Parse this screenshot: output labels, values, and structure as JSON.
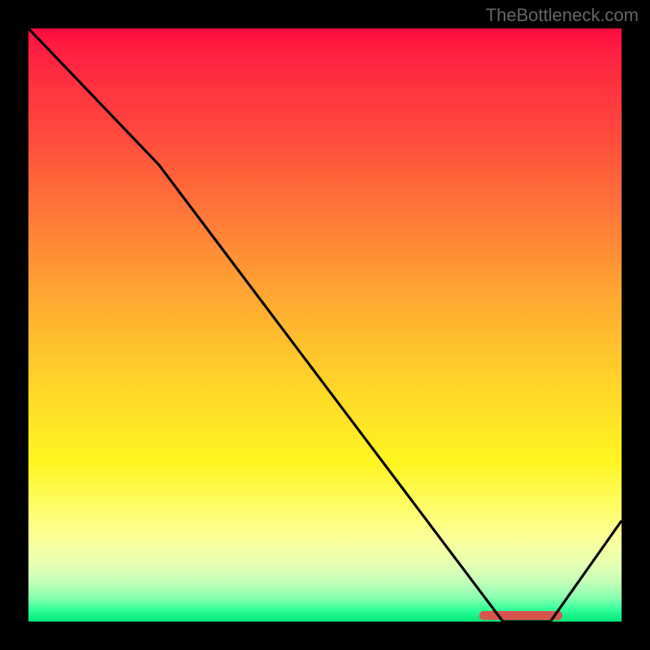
{
  "attribution": "TheBottleneck.com",
  "chart_data": {
    "type": "line",
    "title": "",
    "xlabel": "",
    "ylabel": "",
    "xlim": [
      0,
      100
    ],
    "ylim": [
      0,
      100
    ],
    "x": [
      0,
      22,
      80,
      88,
      100
    ],
    "y": [
      100,
      77,
      0,
      0,
      17
    ],
    "optimum_range": {
      "x_start": 76,
      "x_end": 90,
      "y": 0
    },
    "gradient_stops": [
      {
        "pct": 0,
        "color": "#ff0b3f"
      },
      {
        "pct": 80,
        "color": "#fffc60"
      },
      {
        "pct": 100,
        "color": "#00e878"
      }
    ]
  }
}
